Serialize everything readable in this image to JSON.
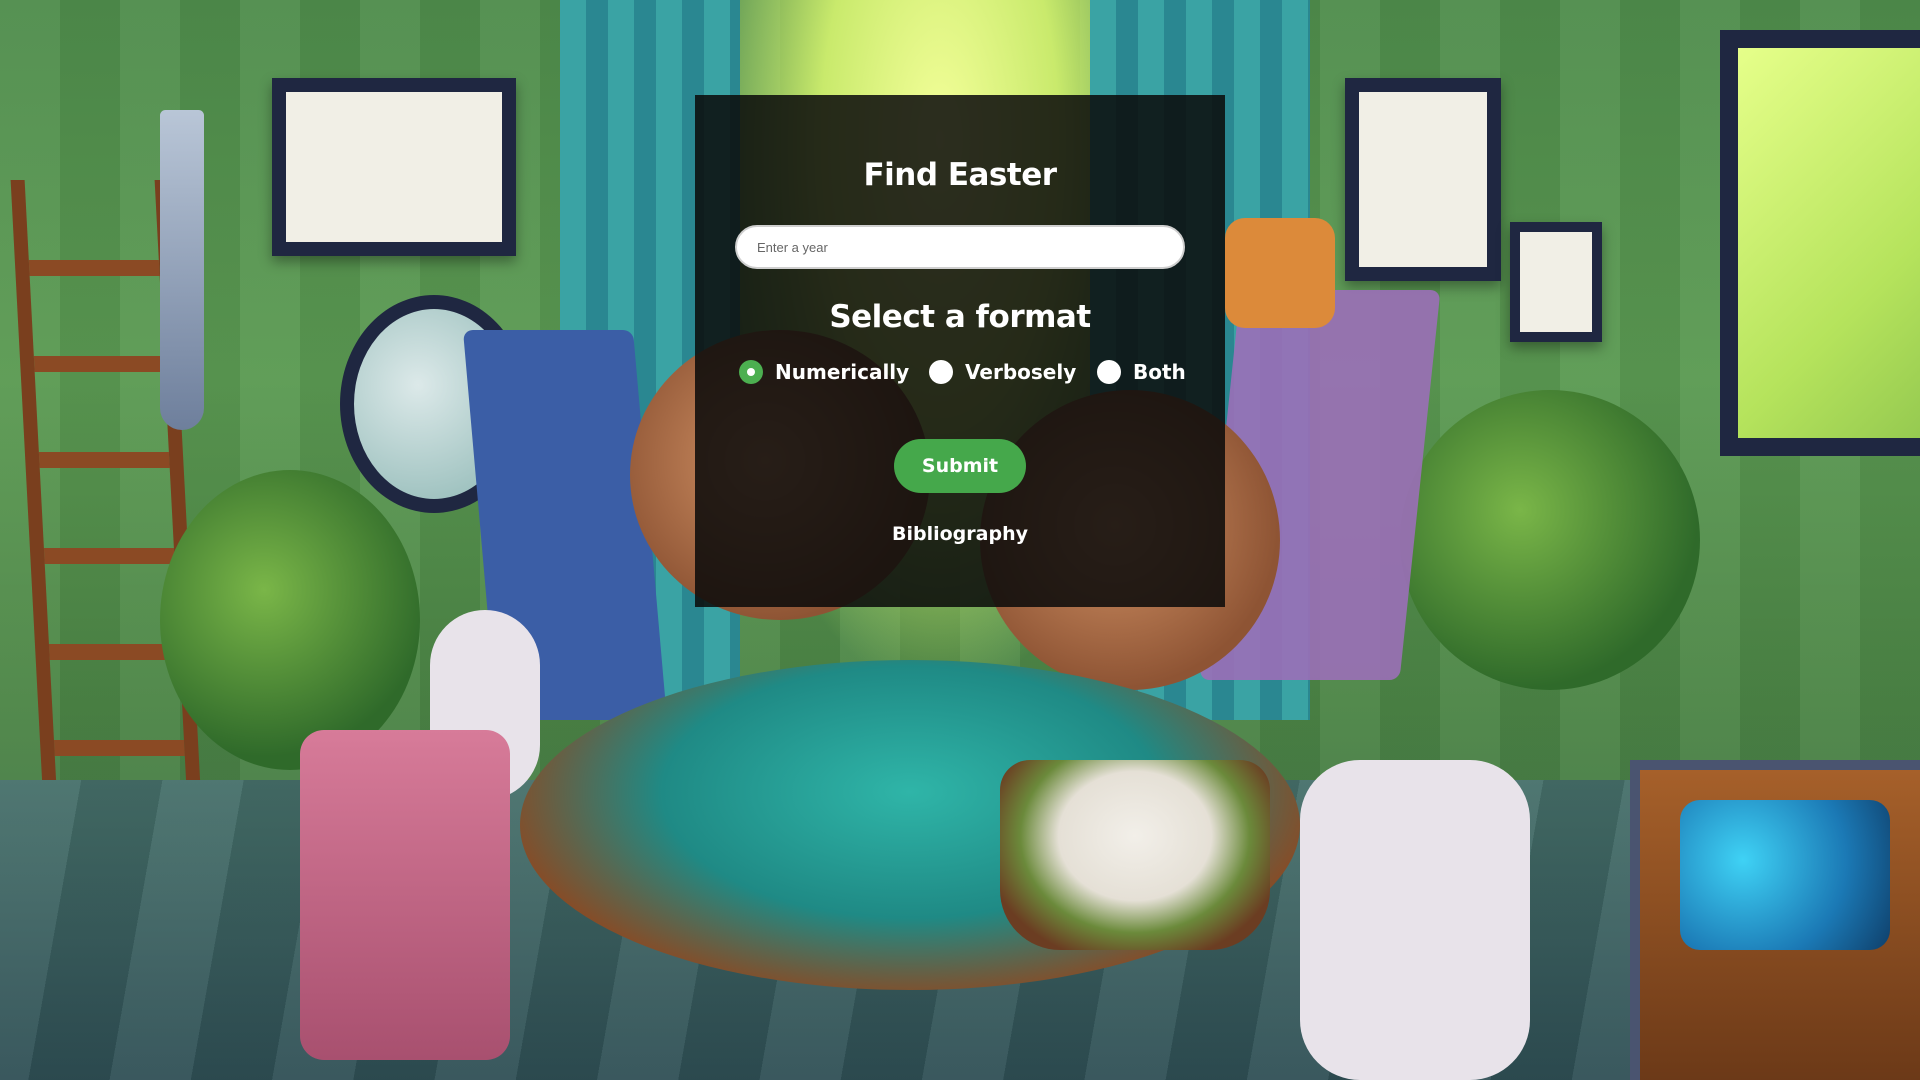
{
  "form": {
    "title": "Find Easter",
    "year_input": {
      "placeholder": "Enter a year",
      "value": ""
    },
    "format_heading": "Select a format",
    "format_options": [
      {
        "label": "Numerically",
        "selected": true
      },
      {
        "label": "Verbosely",
        "selected": false
      },
      {
        "label": "Both",
        "selected": false
      }
    ],
    "submit_label": "Submit",
    "bibliography_link": "Bibliography"
  },
  "colors": {
    "accent_green": "#45a84b",
    "panel_background": "rgba(10,10,10,0.86)",
    "text": "#ffffff"
  },
  "icons": {
    "radio_selected": "radio-checked-icon",
    "radio_unselected": "radio-unchecked-icon"
  }
}
